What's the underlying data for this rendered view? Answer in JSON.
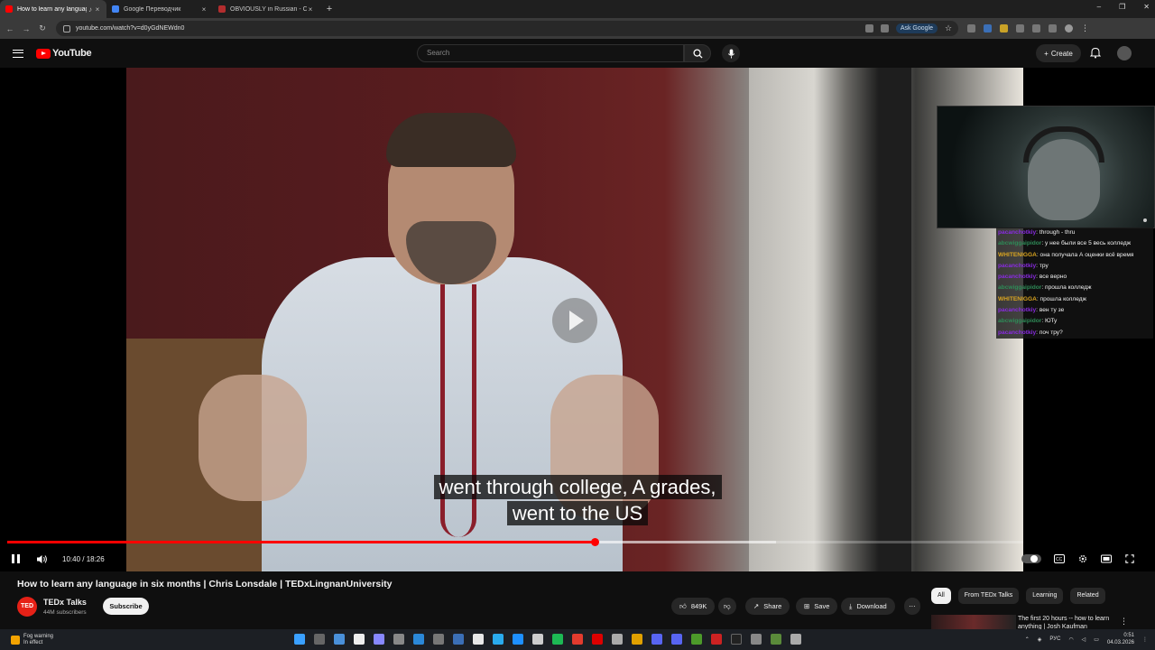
{
  "browser": {
    "tabs": [
      {
        "title": "How to learn any language",
        "color": "#ff0000",
        "active": true
      },
      {
        "title": "Google Переводчик",
        "color": "#4285f4",
        "active": false
      },
      {
        "title": "OBVIOUSLY in Russian - Cambr",
        "color": "#b32d2e",
        "active": false
      }
    ],
    "url": "youtube.com/watch?v=d0yGdNEWdn0",
    "ask_google_label": "Ask Google"
  },
  "youtube": {
    "logo_text": "YouTube",
    "search_placeholder": "Search",
    "create_label": "Create"
  },
  "video": {
    "caption_line1": "went through college, A grades,",
    "caption_line2": "went to the US",
    "time_display": "10:40 / 18:26",
    "progress_fraction": 0.578,
    "buffered_fraction": 0.757
  },
  "chat": [
    {
      "user": "pacanchotkiy",
      "color": "#8a2be2",
      "text": "through - thru"
    },
    {
      "user": "abcwiggaipidor",
      "color": "#2e8b57",
      "text": "у нее были все 5 весь колледж"
    },
    {
      "user": "WHITENIGGA",
      "color": "#daa520",
      "text": "она получала А оценки всё время"
    },
    {
      "user": "pacanchotkiy",
      "color": "#8a2be2",
      "text": "тру"
    },
    {
      "user": "pacanchotkiy",
      "color": "#8a2be2",
      "text": "все верно"
    },
    {
      "user": "abcwiggaipidor",
      "color": "#2e8b57",
      "text": "прошла колледж"
    },
    {
      "user": "WHITENIGGA",
      "color": "#daa520",
      "text": "прошла колледж"
    },
    {
      "user": "pacanchotkiy",
      "color": "#8a2be2",
      "text": "вен ту зе"
    },
    {
      "user": "abcwiggaipidor",
      "color": "#2e8b57",
      "text": "ЮТу"
    },
    {
      "user": "pacanchotkiy",
      "color": "#8a2be2",
      "text": "поч тру?"
    }
  ],
  "meta": {
    "title": "How to learn any language in six months | Chris Lonsdale | TEDxLingnanUniversity",
    "channel_avatar_text": "TED",
    "channel_name": "TEDx Talks",
    "subscribers": "44M subscribers",
    "subscribe_label": "Subscribe",
    "likes": "849K",
    "share_label": "Share",
    "save_label": "Save",
    "download_label": "Download"
  },
  "sidebar": {
    "chips": [
      {
        "label": "All",
        "selected": true
      },
      {
        "label": "From TEDx Talks",
        "selected": false
      },
      {
        "label": "Learning",
        "selected": false
      },
      {
        "label": "Related",
        "selected": false
      }
    ],
    "rec_title": "The first 20 hours -- how to learn anything | Josh Kaufman"
  },
  "taskbar": {
    "weather_line1": "Fog warning",
    "weather_line2": "In effect",
    "lang": "РУС",
    "time": "0:51",
    "date": "04.03.2026"
  }
}
